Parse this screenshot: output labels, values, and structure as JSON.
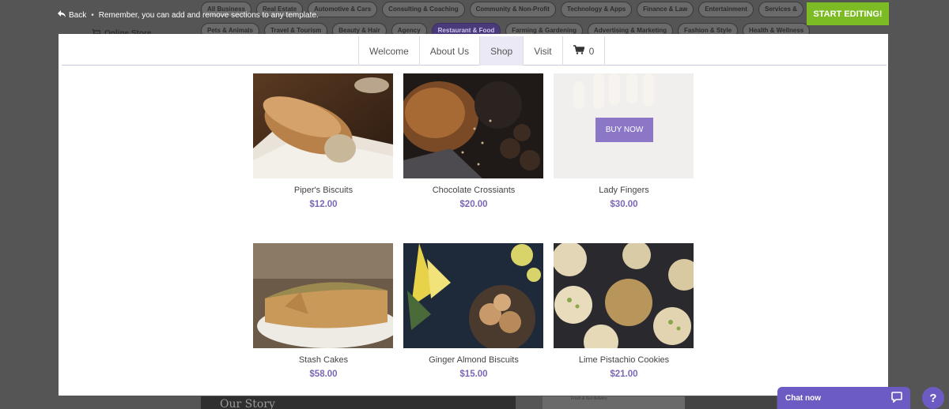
{
  "topbar": {
    "back_label": "Back",
    "notice": "Remember, you can add and remove sections to any template.",
    "store_label": "Online Store",
    "start_editing_label": "START EDITING!"
  },
  "categories_row1": [
    "All Business",
    "Real Estate",
    "Automotive & Cars",
    "Consulting & Coaching",
    "Community & Non-Profit",
    "Technology & Apps",
    "Finance & Law",
    "Entertainment",
    "Services &"
  ],
  "categories_row2": [
    "Pets & Animals",
    "Travel & Tourism",
    "Beauty & Hair",
    "Agency",
    "Restaurant & Food",
    "Farming & Gardening",
    "Advertising & Marketing",
    "Fashion & Style",
    "Health & Wellness"
  ],
  "active_category": "Restaurant & Food",
  "nav": {
    "items": [
      "Welcome",
      "About Us",
      "Shop",
      "Visit"
    ],
    "active": "Shop",
    "cart_count": "0"
  },
  "products": [
    {
      "name": "Piper's Biscuits",
      "price": "$12.00"
    },
    {
      "name": "Chocolate Crossiants",
      "price": "$20.00"
    },
    {
      "name": "Lady Fingers",
      "price": "$30.00",
      "button": "BUY NOW"
    },
    {
      "name": "Stash Cakes",
      "price": "$58.00"
    },
    {
      "name": "Ginger Almond Biscuits",
      "price": "$15.00"
    },
    {
      "name": "Lime Pistachio Cookies",
      "price": "$21.00"
    }
  ],
  "background": {
    "our_story": "Our Story",
    "small_text": "Fresh & fast delivery"
  },
  "chat": {
    "label": "Chat now",
    "help": "?"
  },
  "colors": {
    "accent": "#7c67b6",
    "start_button": "#7dbb25",
    "chat": "#6b5bc2"
  }
}
